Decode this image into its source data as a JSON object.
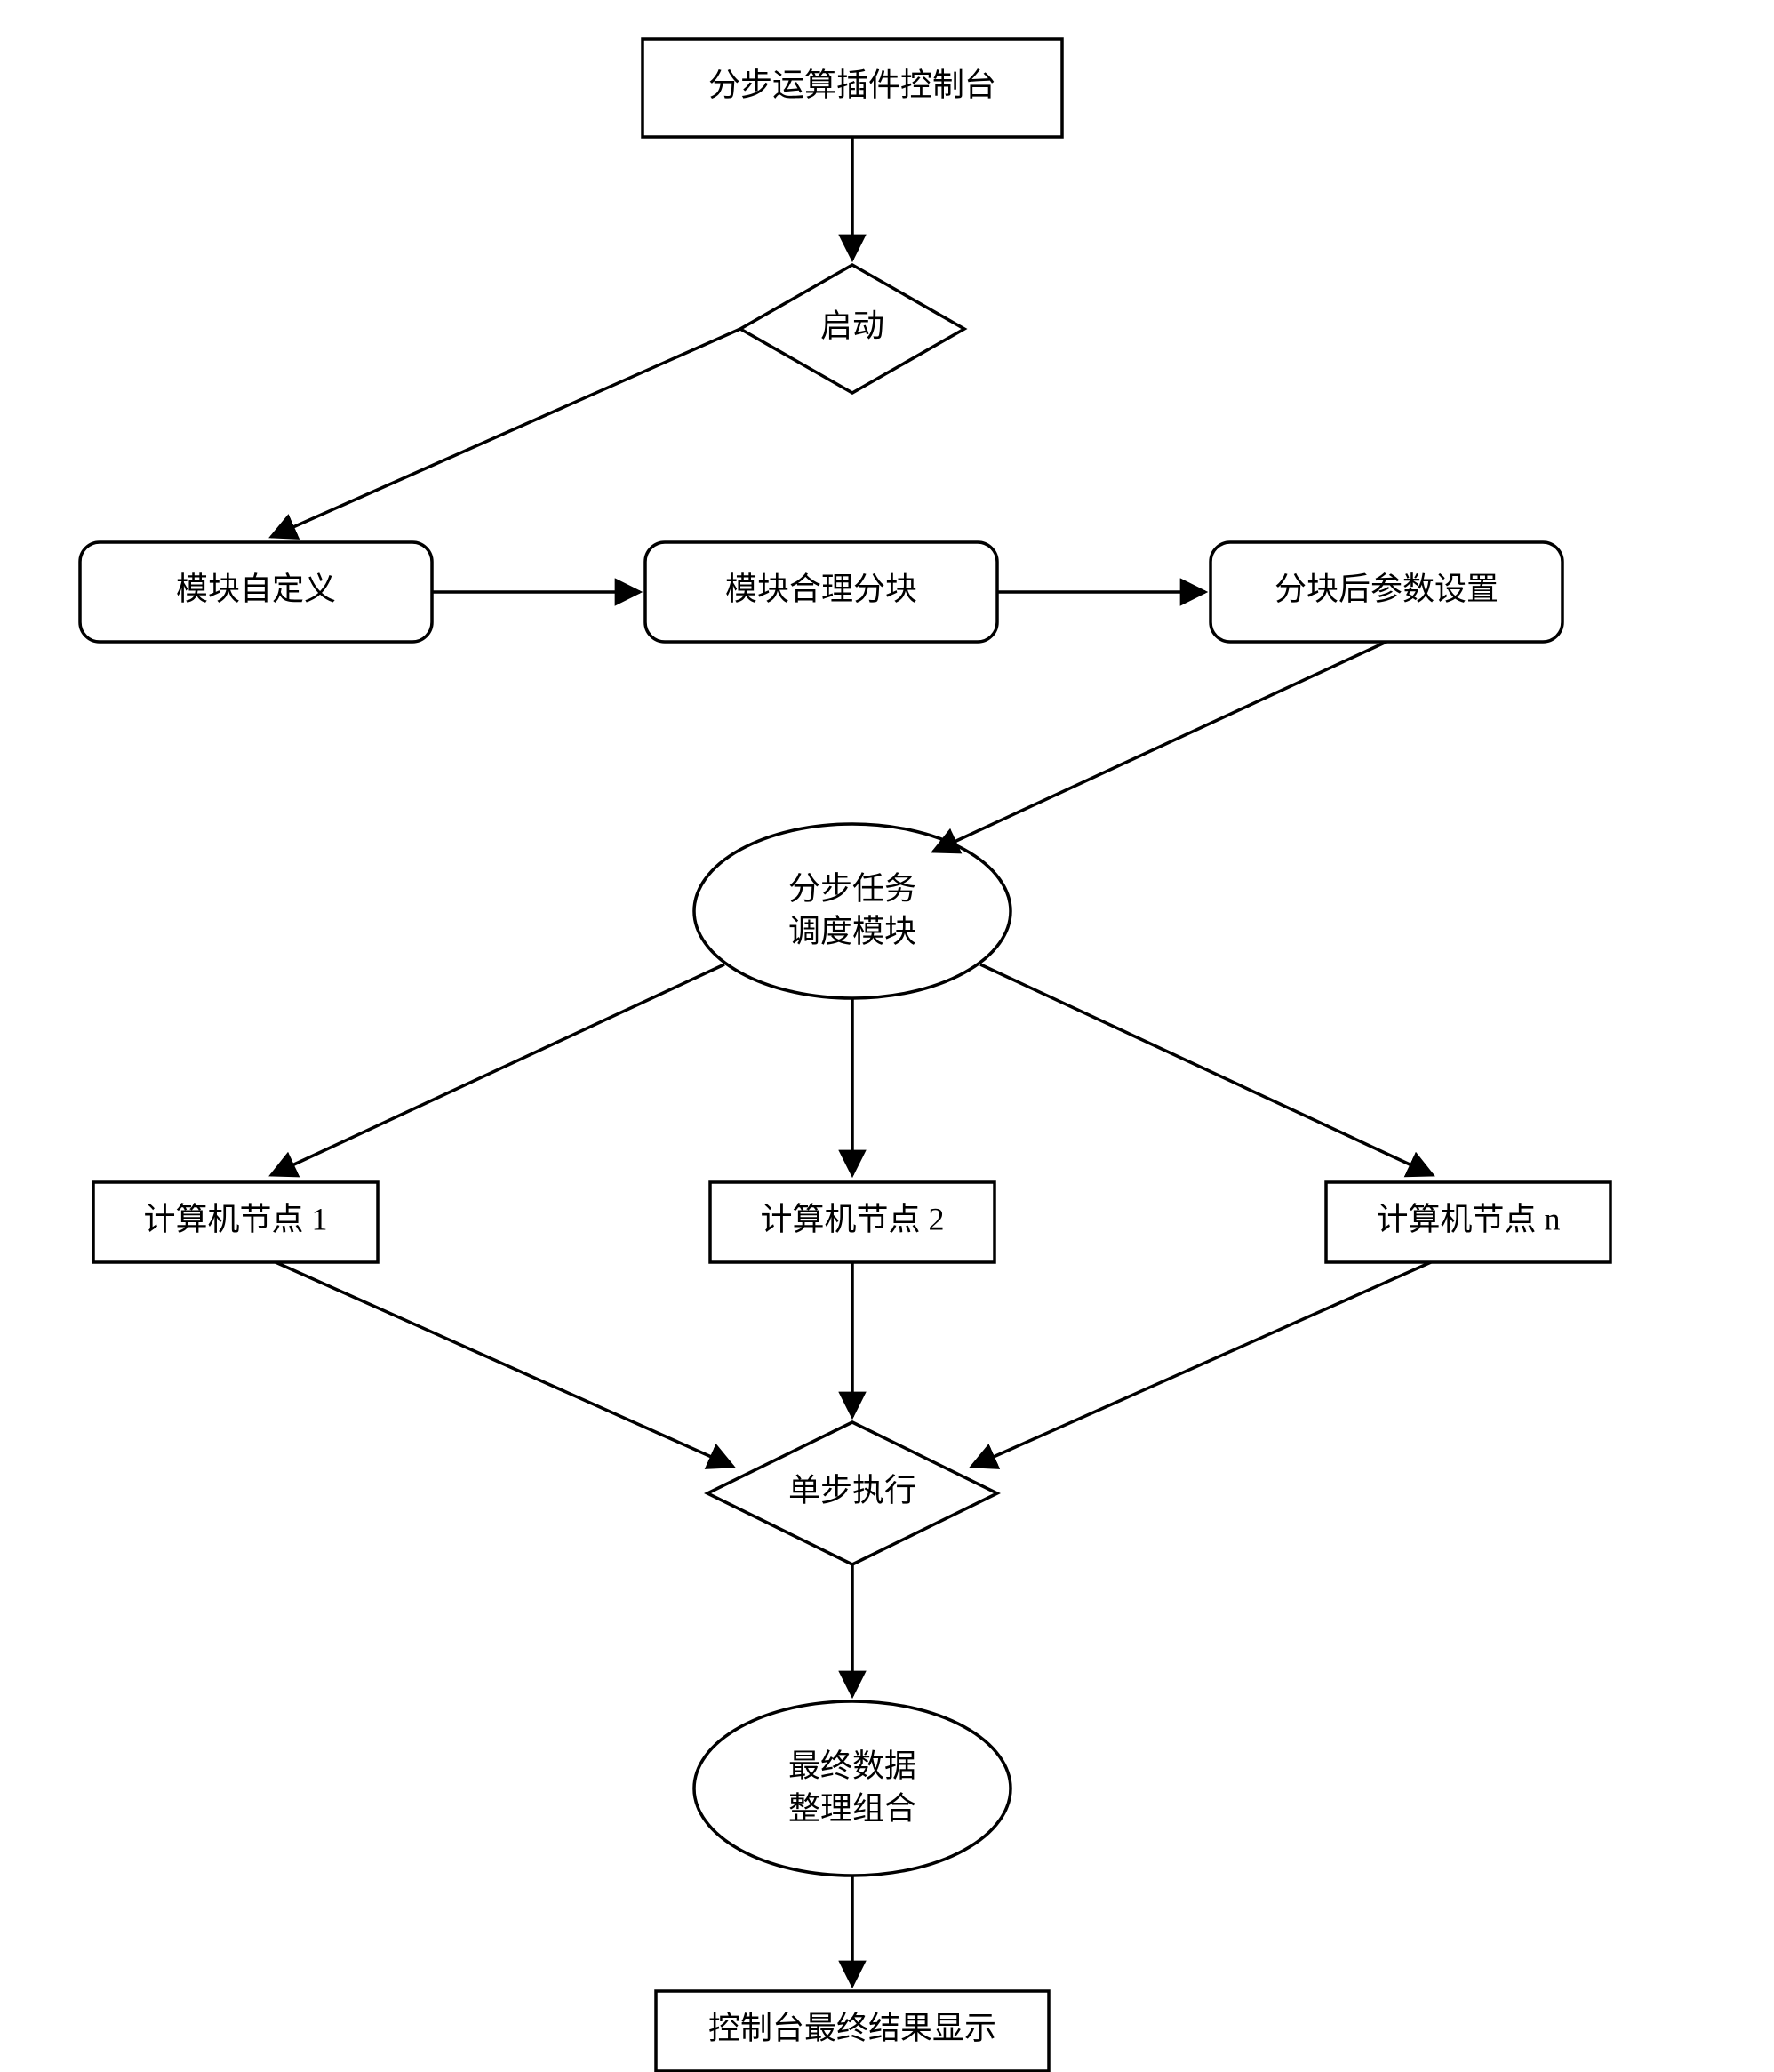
{
  "nodes": {
    "console": "分步运算插件控制台",
    "start": "启动",
    "custom": "模块自定义",
    "split": "模块合理分块",
    "params": "分块后参数设置",
    "sched_l1": "分步任务",
    "sched_l2": "调度模块",
    "node1": "计算机节点 1",
    "node2": "计算机节点 2",
    "noden": "计算机节点 n",
    "step": "单步执行",
    "merge_l1": "最终数据",
    "merge_l2": "整理组合",
    "result": "控制台最终结果显示"
  }
}
